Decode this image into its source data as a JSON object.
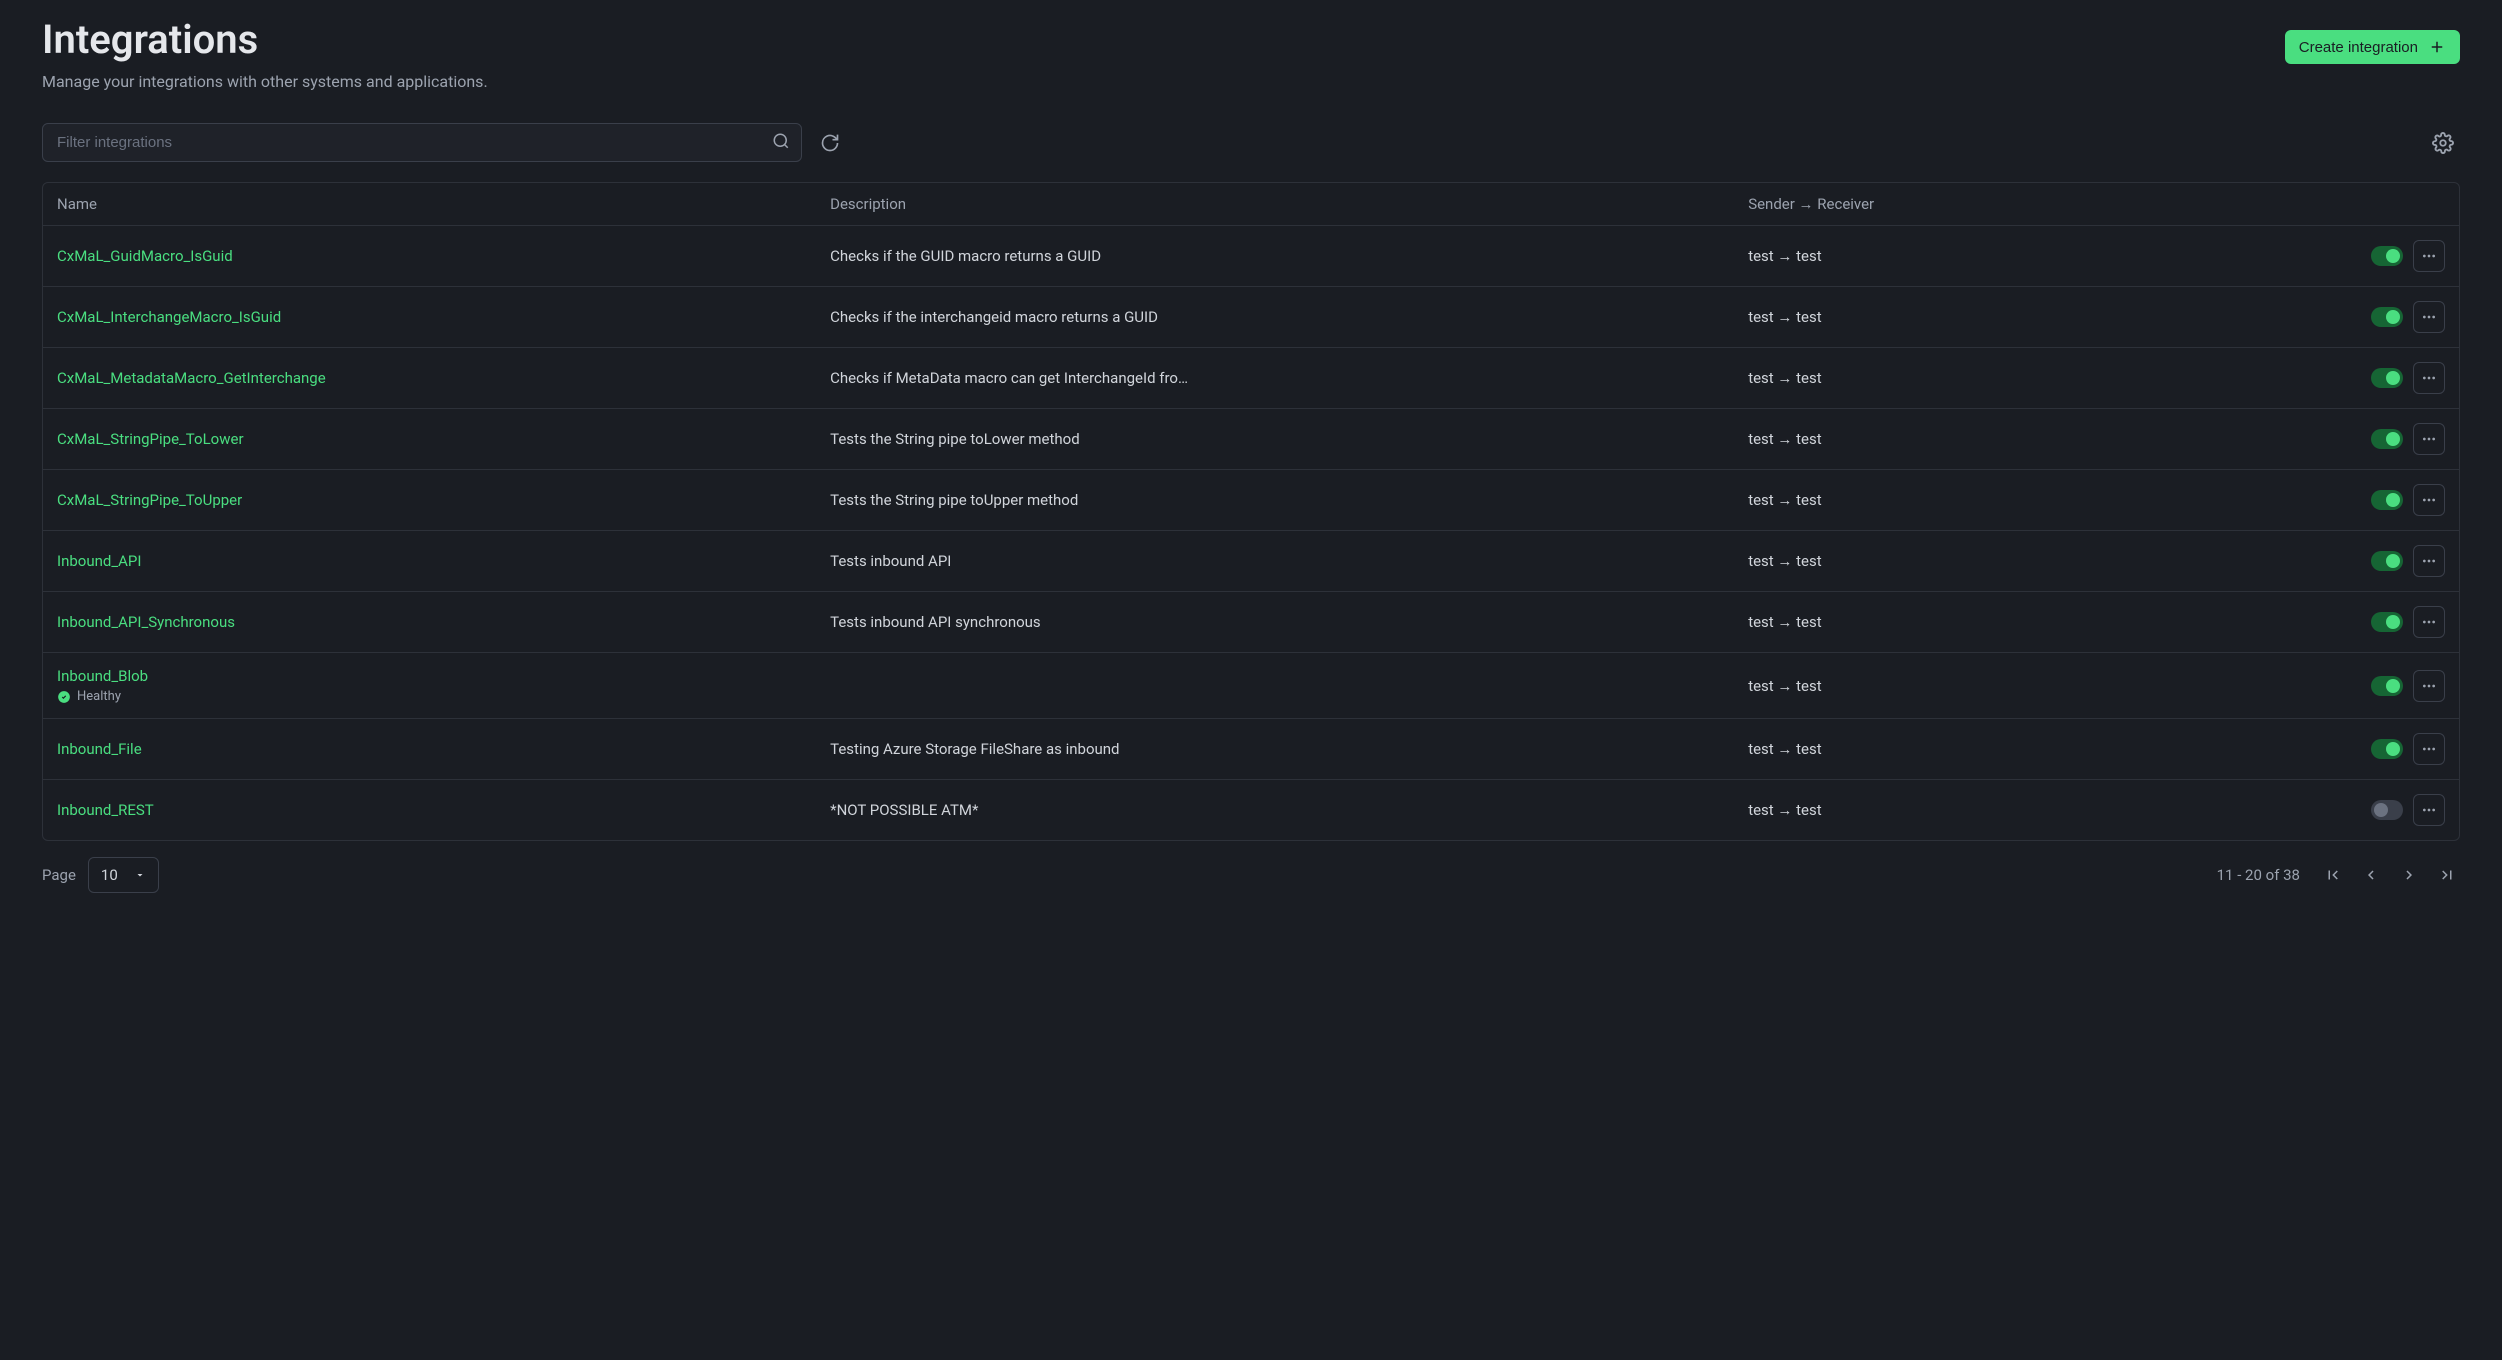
{
  "header": {
    "title": "Integrations",
    "subtitle": "Manage your integrations with other systems and applications.",
    "create_label": "Create integration"
  },
  "search": {
    "placeholder": "Filter integrations"
  },
  "table": {
    "headers": {
      "name": "Name",
      "description": "Description",
      "sender_receiver": "Sender → Receiver"
    },
    "rows": [
      {
        "name": "CxMaL_GuidMacro_IsGuid",
        "description": "Checks if the GUID macro returns a GUID",
        "sender_receiver": "test → test",
        "enabled": true,
        "health": null
      },
      {
        "name": "CxMaL_InterchangeMacro_IsGuid",
        "description": "Checks if the interchangeid macro returns a GUID",
        "sender_receiver": "test → test",
        "enabled": true,
        "health": null
      },
      {
        "name": "CxMaL_MetadataMacro_GetInterchange",
        "description": "Checks if MetaData macro can get InterchangeId fro…",
        "sender_receiver": "test → test",
        "enabled": true,
        "health": null
      },
      {
        "name": "CxMaL_StringPipe_ToLower",
        "description": "Tests the String pipe toLower method",
        "sender_receiver": "test → test",
        "enabled": true,
        "health": null
      },
      {
        "name": "CxMaL_StringPipe_ToUpper",
        "description": "Tests the String pipe toUpper method",
        "sender_receiver": "test → test",
        "enabled": true,
        "health": null
      },
      {
        "name": "Inbound_API",
        "description": "Tests inbound API",
        "sender_receiver": "test → test",
        "enabled": true,
        "health": null
      },
      {
        "name": "Inbound_API_Synchronous",
        "description": "Tests inbound API synchronous",
        "sender_receiver": "test → test",
        "enabled": true,
        "health": null
      },
      {
        "name": "Inbound_Blob",
        "description": "",
        "sender_receiver": "test → test",
        "enabled": true,
        "health": "Healthy"
      },
      {
        "name": "Inbound_File",
        "description": "Testing Azure Storage FileShare as inbound",
        "sender_receiver": "test → test",
        "enabled": true,
        "health": null
      },
      {
        "name": "Inbound_REST",
        "description": "*NOT POSSIBLE ATM*",
        "sender_receiver": "test → test",
        "enabled": false,
        "health": null
      }
    ]
  },
  "pagination": {
    "page_label": "Page",
    "page_size": "10",
    "range": "11 - 20 of 38"
  }
}
